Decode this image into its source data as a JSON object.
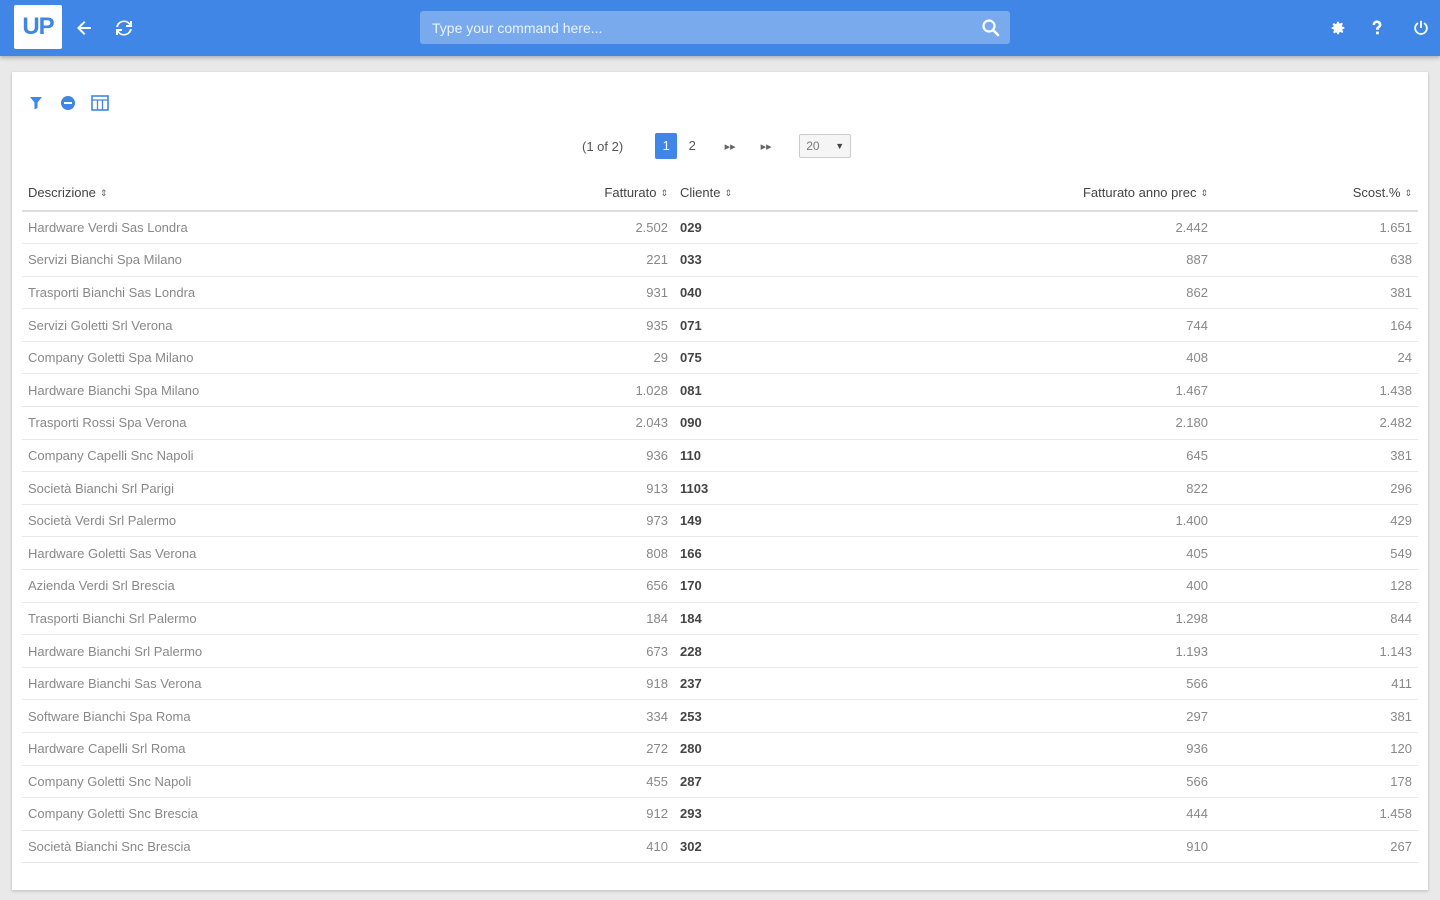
{
  "topbar": {
    "logo": "UP",
    "command_placeholder": "Type your command here..."
  },
  "toolbar_icons": [
    "filter-icon",
    "minus-circle-icon",
    "columns-icon"
  ],
  "pager": {
    "info": "(1 of 2)",
    "pages": [
      "1",
      "2"
    ],
    "current_page": "1",
    "prev_label": "◂◂",
    "next_label": "▸▸",
    "rows_per_page": "20"
  },
  "table": {
    "columns": [
      "Descrizione",
      "Fatturato",
      "Cliente",
      "Fatturato anno prec",
      "Scost.%"
    ],
    "sort_glyph": "⇕",
    "rows": [
      [
        "Hardware Verdi Sas Londra",
        "2.502",
        "029",
        "2.442",
        "1.651"
      ],
      [
        "Servizi Bianchi Spa Milano",
        "221",
        "033",
        "887",
        "638"
      ],
      [
        "Trasporti Bianchi Sas Londra",
        "931",
        "040",
        "862",
        "381"
      ],
      [
        "Servizi Goletti Srl Verona",
        "935",
        "071",
        "744",
        "164"
      ],
      [
        "Company Goletti Spa Milano",
        "29",
        "075",
        "408",
        "24"
      ],
      [
        "Hardware Bianchi Spa Milano",
        "1.028",
        "081",
        "1.467",
        "1.438"
      ],
      [
        "Trasporti Rossi Spa Verona",
        "2.043",
        "090",
        "2.180",
        "2.482"
      ],
      [
        "Company Capelli Snc Napoli",
        "936",
        "110",
        "645",
        "381"
      ],
      [
        "Società Bianchi Srl Parigi",
        "913",
        "1103",
        "822",
        "296"
      ],
      [
        "Società Verdi Srl Palermo",
        "973",
        "149",
        "1.400",
        "429"
      ],
      [
        "Hardware Goletti Sas Verona",
        "808",
        "166",
        "405",
        "549"
      ],
      [
        "Azienda Verdi Srl Brescia",
        "656",
        "170",
        "400",
        "128"
      ],
      [
        "Trasporti Bianchi Srl Palermo",
        "184",
        "184",
        "1.298",
        "844"
      ],
      [
        "Hardware Bianchi Srl Palermo",
        "673",
        "228",
        "1.193",
        "1.143"
      ],
      [
        "Hardware Bianchi Sas Verona",
        "918",
        "237",
        "566",
        "411"
      ],
      [
        "Software Bianchi Spa Roma",
        "334",
        "253",
        "297",
        "381"
      ],
      [
        "Hardware Capelli Srl Roma",
        "272",
        "280",
        "936",
        "120"
      ],
      [
        "Company Goletti Snc Napoli",
        "455",
        "287",
        "566",
        "178"
      ],
      [
        "Company Goletti Snc Brescia",
        "912",
        "293",
        "444",
        "1.458"
      ],
      [
        "Società Bianchi Snc Brescia",
        "410",
        "302",
        "910",
        "267"
      ]
    ]
  },
  "colors": {
    "primary": "#3f86e6"
  }
}
